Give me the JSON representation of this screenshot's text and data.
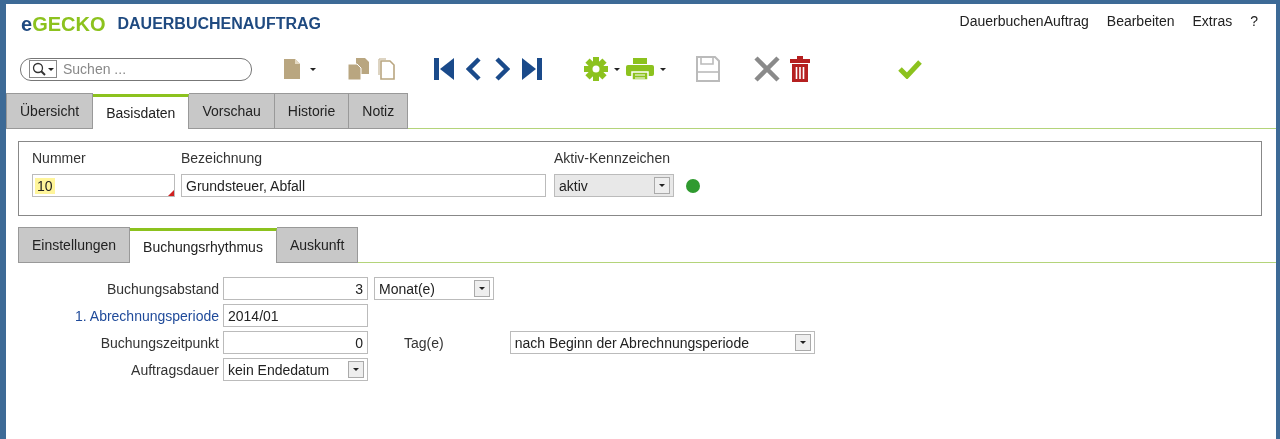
{
  "app": {
    "logo_prefix": "e",
    "logo_main": "GECKO",
    "title": "DAUERBUCHENAUFTRAG"
  },
  "menu": [
    "DauerbuchenAuftrag",
    "Bearbeiten",
    "Extras",
    "?"
  ],
  "search": {
    "placeholder": "Suchen ..."
  },
  "toolbar": {
    "save_disabled": true
  },
  "tabs": [
    {
      "label": "Übersicht",
      "selected": false
    },
    {
      "label": "Basisdaten",
      "selected": true
    },
    {
      "label": "Vorschau",
      "selected": false
    },
    {
      "label": "Historie",
      "selected": false
    },
    {
      "label": "Notiz",
      "selected": false
    }
  ],
  "header": {
    "fields": [
      {
        "label": "Nummer",
        "value": "10",
        "highlighted": true,
        "required": true,
        "kind": "text"
      },
      {
        "label": "Bezeichnung",
        "value": "Grundsteuer, Abfall",
        "highlighted": false,
        "required": false,
        "kind": "text"
      },
      {
        "label": "Aktiv-Kennzeichen",
        "value": "aktiv",
        "highlighted": false,
        "required": false,
        "kind": "select"
      }
    ],
    "status": {
      "color": "#2f9a2f"
    }
  },
  "subtabs": [
    {
      "label": "Einstellungen",
      "selected": false
    },
    {
      "label": "Buchungsrhythmus",
      "selected": true
    },
    {
      "label": "Auskunft",
      "selected": false
    }
  ],
  "form": {
    "rows": [
      {
        "label": "Buchungsabstand",
        "kind": "plain",
        "items": [
          {
            "kind": "number",
            "value": "3"
          },
          {
            "kind": "select",
            "value": "Monat(e)"
          }
        ]
      },
      {
        "label": "1. Abrechnungsperiode",
        "kind": "link",
        "items": [
          {
            "kind": "text",
            "value": "2014/01"
          }
        ]
      },
      {
        "label": "Buchungszeitpunkt",
        "kind": "plain",
        "items": [
          {
            "kind": "number",
            "value": "0"
          },
          {
            "kind": "label",
            "value": "Tag(e)"
          },
          {
            "kind": "select",
            "value": "nach Beginn der Abrechnungsperiode"
          }
        ]
      },
      {
        "label": "Auftragsdauer",
        "kind": "plain",
        "items": [
          {
            "kind": "select",
            "value": "kein Endedatum"
          }
        ]
      }
    ]
  }
}
